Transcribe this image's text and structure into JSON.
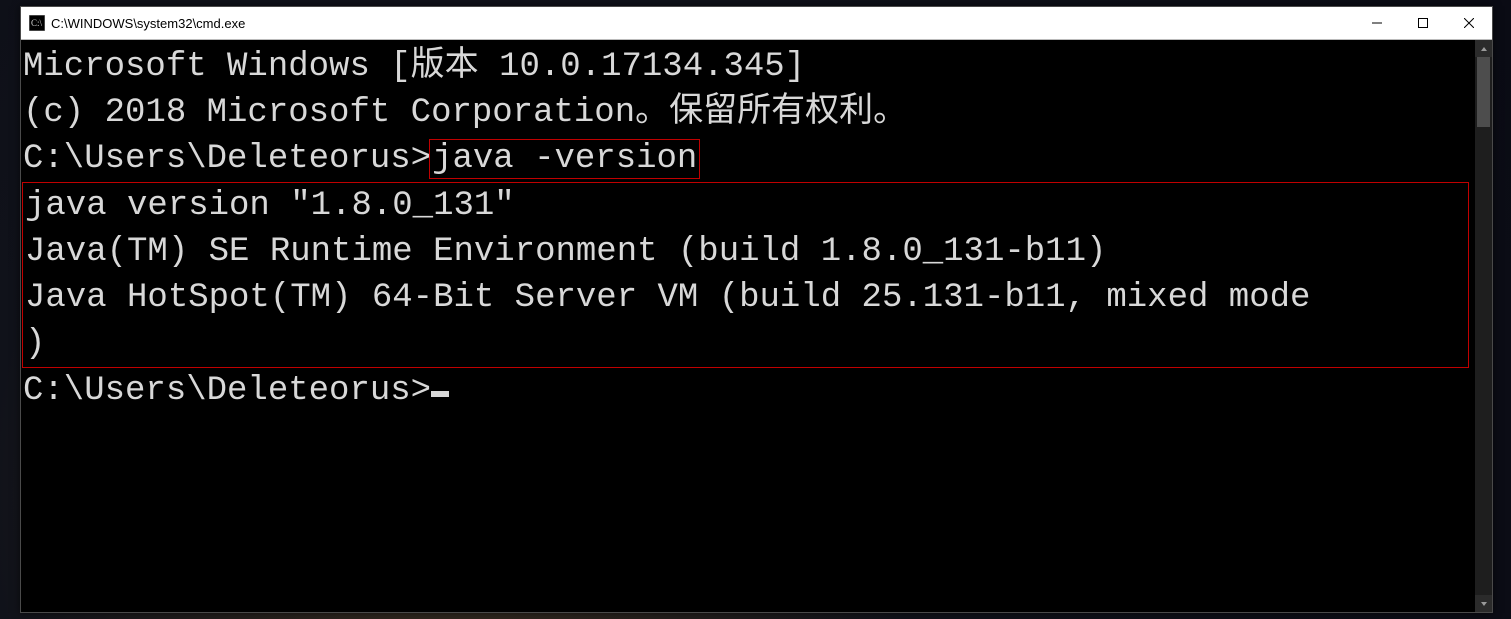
{
  "window": {
    "title": "C:\\WINDOWS\\system32\\cmd.exe"
  },
  "terminal": {
    "banner_line1": "Microsoft Windows [版本 10.0.17134.345]",
    "banner_line2": "(c) 2018 Microsoft Corporation。保留所有权利。",
    "blank": "",
    "prompt1_prefix": "C:\\Users\\Deleteorus>",
    "prompt1_cmd": "java -version",
    "output_line1": "java version \"1.8.0_131\"",
    "output_line2": "Java(TM) SE Runtime Environment (build 1.8.0_131-b11)",
    "output_line3": "Java HotSpot(TM) 64-Bit Server VM (build 25.131-b11, mixed mode",
    "output_line4": ")",
    "prompt2_prefix": "C:\\Users\\Deleteorus>"
  }
}
